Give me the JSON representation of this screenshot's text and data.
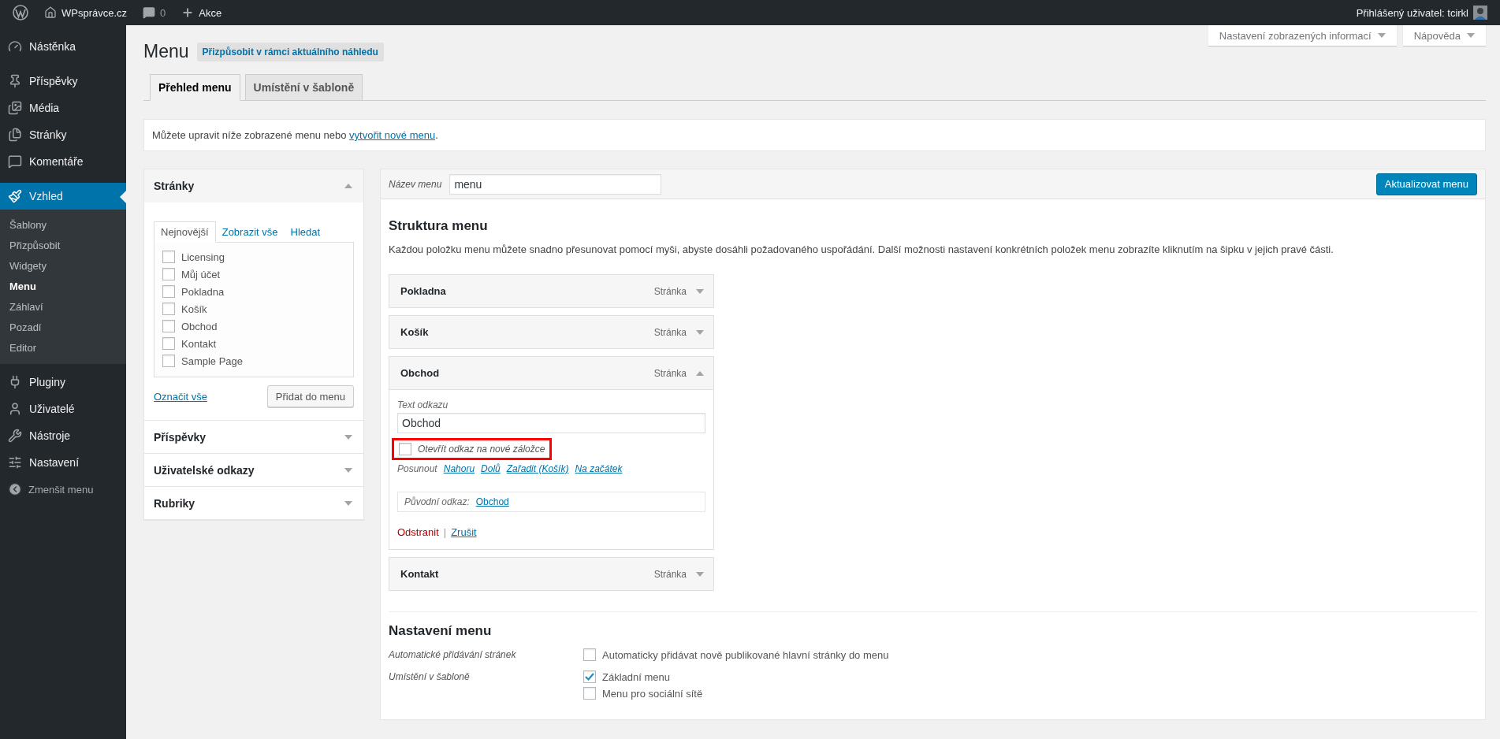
{
  "admin_bar": {
    "site": "WPsprávce.cz",
    "comments": "0",
    "new": "Akce",
    "account": "Přihlášený uživatel: tcirkl"
  },
  "sidebar": {
    "items": [
      {
        "label": "Nástěnka",
        "kind": "dashboard",
        "selected": false
      },
      {
        "label": "Příspěvky",
        "kind": "posts",
        "selected": false
      },
      {
        "label": "Média",
        "kind": "media",
        "selected": false
      },
      {
        "label": "Stránky",
        "kind": "pages",
        "selected": false
      },
      {
        "label": "Komentáře",
        "kind": "comments",
        "selected": false
      },
      {
        "label": "Vzhled",
        "kind": "appearance",
        "selected": true,
        "children": [
          {
            "label": "Šablony",
            "selected": false
          },
          {
            "label": "Přizpůsobit",
            "selected": false
          },
          {
            "label": "Widgety",
            "selected": false
          },
          {
            "label": "Menu",
            "selected": true
          },
          {
            "label": "Záhlaví",
            "selected": false
          },
          {
            "label": "Pozadí",
            "selected": false
          },
          {
            "label": "Editor",
            "selected": false
          }
        ]
      },
      {
        "label": "Pluginy",
        "kind": "plugins",
        "selected": false
      },
      {
        "label": "Uživatelé",
        "kind": "users",
        "selected": false
      },
      {
        "label": "Nástroje",
        "kind": "tools",
        "selected": false
      },
      {
        "label": "Nastavení",
        "kind": "settings",
        "selected": false
      }
    ],
    "collapse": "Zmenšit menu"
  },
  "screen_options": [
    "Nastavení zobrazených informací",
    "Nápověda"
  ],
  "page": {
    "title": "Menu",
    "customize": "Přizpůsobit v rámci aktuálního náhledu"
  },
  "tabs": [
    {
      "label": "Přehled menu",
      "selected": true
    },
    {
      "label": "Umístění v šabloně",
      "selected": false
    }
  ],
  "notice": {
    "text": "Můžete upravit níže zobrazené menu nebo ",
    "link": "vytvořit nové menu",
    "end": "."
  },
  "add_panels": [
    {
      "title": "Stránky",
      "expanded": true,
      "tabs": [
        {
          "label": "Nejnovější",
          "selected": true
        },
        {
          "label": "Zobrazit vše",
          "selected": false
        },
        {
          "label": "Hledat",
          "selected": false
        }
      ],
      "items": [
        {
          "label": "Licensing",
          "checked": false
        },
        {
          "label": "Můj účet",
          "checked": false
        },
        {
          "label": "Pokladna",
          "checked": false
        },
        {
          "label": "Košík",
          "checked": false
        },
        {
          "label": "Obchod",
          "checked": false
        },
        {
          "label": "Kontakt",
          "checked": false
        },
        {
          "label": "Sample Page",
          "checked": false
        }
      ],
      "select_all": "Označit vše",
      "add_button": "Přidat do menu"
    },
    {
      "title": "Příspěvky",
      "expanded": false
    },
    {
      "title": "Uživatelské odkazy",
      "expanded": false
    },
    {
      "title": "Rubriky",
      "expanded": false
    }
  ],
  "editor": {
    "name_label": "Název menu",
    "name_value": "menu",
    "save": "Aktualizovat menu",
    "structure_title": "Struktura menu",
    "structure_help": "Každou položku menu můžete snadno přesunovat pomocí myši, abyste dosáhli požadovaného uspořádání. Další možnosti nastavení konkrétních položek menu zobrazíte kliknutím na šipku v jejich pravé části.",
    "items": [
      {
        "title": "Pokladna",
        "type": "Stránka",
        "expanded": false
      },
      {
        "title": "Košík",
        "type": "Stránka",
        "expanded": false
      },
      {
        "title": "Obchod",
        "type": "Stránka",
        "expanded": true,
        "details": {
          "label_caption": "Text odkazu",
          "label_value": "Obchod",
          "new_tab": {
            "label": "Otevřít odkaz na nové záložce",
            "checked": false,
            "highlighted": true
          },
          "move_caption": "Posunout",
          "move_links": [
            "Nahoru",
            "Dolů",
            "Zařadit (Košík)",
            "Na začátek"
          ],
          "original_caption": "Původní odkaz:",
          "original_link": "Obchod",
          "remove": "Odstranit",
          "separator": "|",
          "cancel": "Zrušit"
        }
      },
      {
        "title": "Kontakt",
        "type": "Stránka",
        "expanded": false
      }
    ],
    "settings": {
      "title": "Nastavení menu",
      "rows": [
        {
          "label": "Automatické přidávání stránek",
          "options": [
            {
              "label": "Automaticky přidávat nově publikované hlavní stránky do menu",
              "checked": false
            }
          ]
        },
        {
          "label": "Umístění v šabloně",
          "options": [
            {
              "label": "Základní menu",
              "checked": true
            },
            {
              "label": "Menu pro sociální sítě",
              "checked": false
            }
          ]
        }
      ]
    }
  }
}
